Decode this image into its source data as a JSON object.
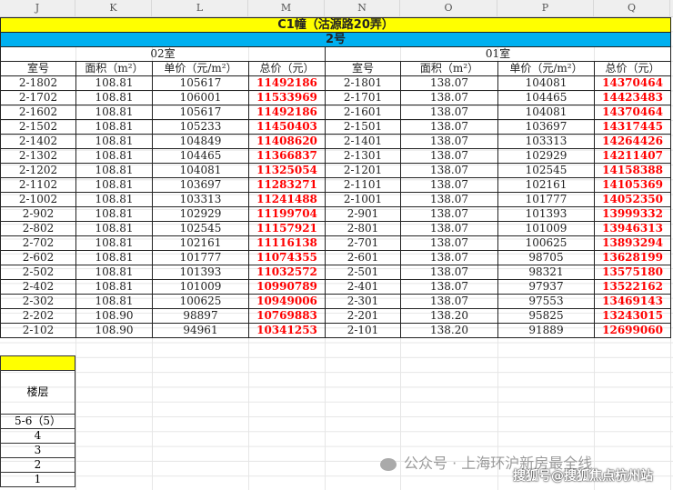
{
  "columns": [
    "J",
    "K",
    "L",
    "M",
    "N",
    "O",
    "P",
    "Q"
  ],
  "title": "C1幢（沽源路20弄）",
  "building": "2号",
  "rooms": [
    {
      "label": "02室",
      "headers": [
        "室号",
        "面积（m²）",
        "单价（元/m²）",
        "总价（元）"
      ],
      "rows": [
        [
          "2-1802",
          "108.81",
          "105617",
          "11492186"
        ],
        [
          "2-1702",
          "108.81",
          "106001",
          "11533969"
        ],
        [
          "2-1602",
          "108.81",
          "105617",
          "11492186"
        ],
        [
          "2-1502",
          "108.81",
          "105233",
          "11450403"
        ],
        [
          "2-1402",
          "108.81",
          "104849",
          "11408620"
        ],
        [
          "2-1302",
          "108.81",
          "104465",
          "11366837"
        ],
        [
          "2-1202",
          "108.81",
          "104081",
          "11325054"
        ],
        [
          "2-1102",
          "108.81",
          "103697",
          "11283271"
        ],
        [
          "2-1002",
          "108.81",
          "103313",
          "11241488"
        ],
        [
          "2-902",
          "108.81",
          "102929",
          "11199704"
        ],
        [
          "2-802",
          "108.81",
          "102545",
          "11157921"
        ],
        [
          "2-702",
          "108.81",
          "102161",
          "11116138"
        ],
        [
          "2-602",
          "108.81",
          "101777",
          "11074355"
        ],
        [
          "2-502",
          "108.81",
          "101393",
          "11032572"
        ],
        [
          "2-402",
          "108.81",
          "101009",
          "10990789"
        ],
        [
          "2-302",
          "108.81",
          "100625",
          "10949006"
        ],
        [
          "2-202",
          "108.90",
          "98897",
          "10769883"
        ],
        [
          "2-102",
          "108.90",
          "94961",
          "10341253"
        ]
      ]
    },
    {
      "label": "01室",
      "headers": [
        "室号",
        "面积（m²）",
        "单价（元/m²）",
        "总价（元）"
      ],
      "rows": [
        [
          "2-1801",
          "138.07",
          "104081",
          "14370464"
        ],
        [
          "2-1701",
          "138.07",
          "104465",
          "14423483"
        ],
        [
          "2-1601",
          "138.07",
          "104081",
          "14370464"
        ],
        [
          "2-1501",
          "138.07",
          "103697",
          "14317445"
        ],
        [
          "2-1401",
          "138.07",
          "103313",
          "14264426"
        ],
        [
          "2-1301",
          "138.07",
          "102929",
          "14211407"
        ],
        [
          "2-1201",
          "138.07",
          "102545",
          "14158388"
        ],
        [
          "2-1101",
          "138.07",
          "102161",
          "14105369"
        ],
        [
          "2-1001",
          "138.07",
          "101777",
          "14052350"
        ],
        [
          "2-901",
          "138.07",
          "101393",
          "13999332"
        ],
        [
          "2-801",
          "138.07",
          "101009",
          "13946313"
        ],
        [
          "2-701",
          "138.07",
          "100625",
          "13893294"
        ],
        [
          "2-601",
          "138.07",
          "98705",
          "13628199"
        ],
        [
          "2-501",
          "138.07",
          "98321",
          "13575180"
        ],
        [
          "2-401",
          "138.07",
          "97937",
          "13522162"
        ],
        [
          "2-301",
          "138.07",
          "97553",
          "13469143"
        ],
        [
          "2-201",
          "138.20",
          "95825",
          "13243015"
        ],
        [
          "2-101",
          "138.20",
          "91889",
          "12699060"
        ]
      ]
    }
  ],
  "floor_table": {
    "header": "楼层",
    "rows": [
      "5-6（5）",
      "4",
      "3",
      "2",
      "1"
    ]
  },
  "watermark": {
    "line1": "公众号 · 上海环沪新房最全线",
    "line2": "搜狐号@搜狐焦点杭州站"
  },
  "colors": {
    "title_bg": "#ffff00",
    "building_bg": "#00b0f0",
    "price": "#ff0000"
  }
}
